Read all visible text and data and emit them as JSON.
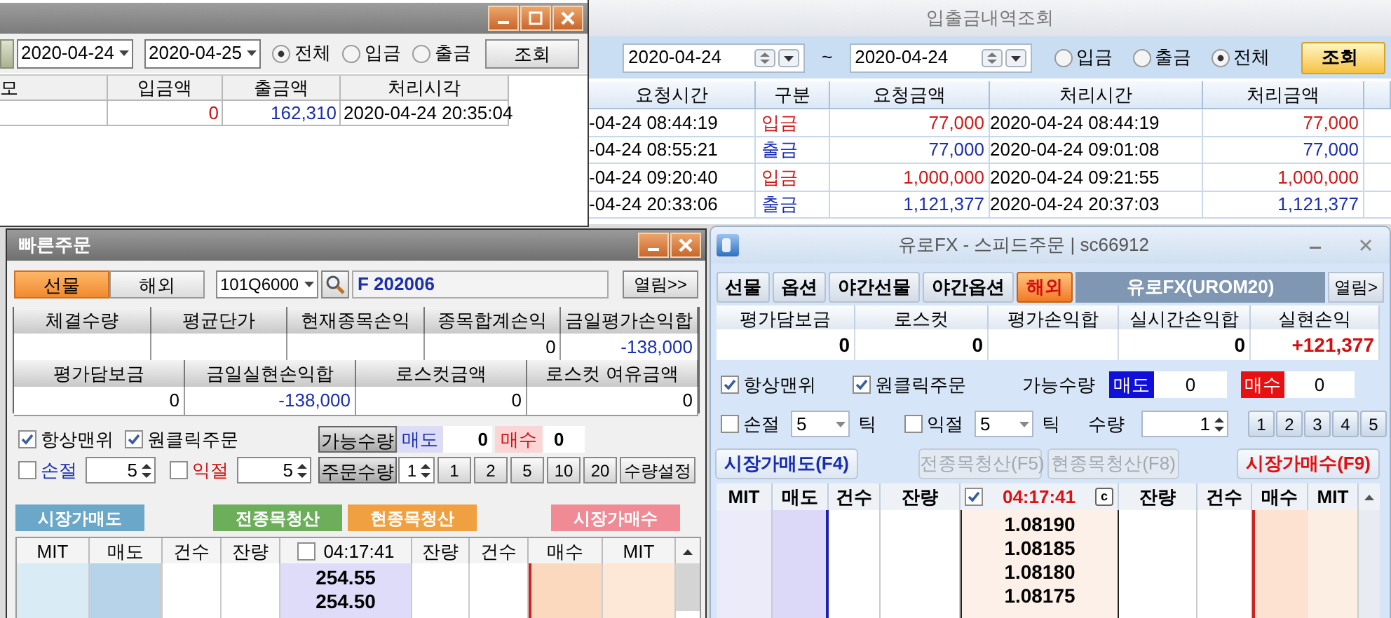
{
  "transfer_window": {
    "date_from": "2020-04-24",
    "date_to": "2020-04-25",
    "filters": [
      {
        "label": "전체",
        "selected": true
      },
      {
        "label": "입금",
        "selected": false
      },
      {
        "label": "출금",
        "selected": false
      }
    ],
    "query_button": "조회",
    "columns": [
      "모",
      "입금액",
      "출금액",
      "처리시각"
    ],
    "rows": [
      {
        "cells": [
          {
            "kind": "blank"
          },
          {
            "kind": "loss_red",
            "text": "0"
          },
          {
            "kind": "blue",
            "text": "162,310"
          },
          {
            "kind": "plain",
            "text": "2020-04-24 20:35:04"
          }
        ]
      }
    ]
  },
  "history_window": {
    "title": "입출금내역조회",
    "date_from": "2020-04-24",
    "separator": "~",
    "date_to": "2020-04-24",
    "filters": [
      {
        "label": "입금",
        "selected": false
      },
      {
        "label": "출금",
        "selected": false
      },
      {
        "label": "전체",
        "selected": true
      }
    ],
    "query_button": "조회",
    "columns": [
      "요청시간",
      "구분",
      "요청금액",
      "처리시간",
      "처리금액"
    ],
    "rows": [
      {
        "kind": "deposit",
        "cells": [
          "-04-24 08:44:19",
          "입금",
          "77,000",
          "2020-04-24 08:44:19",
          "77,000"
        ]
      },
      {
        "kind": "withdrawal",
        "cells": [
          "-04-24 08:55:21",
          "출금",
          "77,000",
          "2020-04-24 09:01:08",
          "77,000"
        ]
      },
      {
        "kind": "deposit",
        "cells": [
          "-04-24 09:20:40",
          "입금",
          "1,000,000",
          "2020-04-24 09:21:55",
          "1,000,000"
        ]
      },
      {
        "kind": "withdrawal",
        "cells": [
          "-04-24 20:33:06",
          "출금",
          "1,121,377",
          "2020-04-24 20:37:03",
          "1,121,377"
        ]
      }
    ]
  },
  "quick_order": {
    "title": "빠른주문",
    "market_tabs": [
      {
        "label": "선물",
        "selected": true
      },
      {
        "label": "해외",
        "selected": false
      }
    ],
    "symbol_code": "101Q6000",
    "symbol_name": "F 202006",
    "expand_button": "열림>>",
    "summary_1": {
      "columns": [
        "체결수량",
        "평균단가",
        "현재종목손익",
        "종목합계손익",
        "금일평가손익합"
      ],
      "values": [
        {
          "kind": "blank"
        },
        {
          "kind": "blank"
        },
        {
          "kind": "blank"
        },
        {
          "kind": "plain",
          "text": "0"
        },
        {
          "kind": "blue",
          "text": "-138,000"
        }
      ]
    },
    "summary_2": {
      "columns": [
        "평가담보금",
        "금일실현손익합",
        "로스컷금액",
        "로스컷 여유금액"
      ],
      "values": [
        {
          "kind": "plain",
          "text": "0"
        },
        {
          "kind": "blue",
          "text": "-138,000"
        },
        {
          "kind": "plain",
          "text": "0"
        },
        {
          "kind": "plain",
          "text": "0"
        }
      ]
    },
    "always_on_top": {
      "label": "항상맨위",
      "checked": true
    },
    "one_click": {
      "label": "원클릭주문",
      "checked": true
    },
    "stop_loss": {
      "label": "손절",
      "checked": false,
      "value": "5"
    },
    "take_profit": {
      "label": "익절",
      "checked": false,
      "value": "5"
    },
    "available_button": "가능수량",
    "sell_label": "매도",
    "sell_qty": "0",
    "buy_label": "매수",
    "buy_qty": "0",
    "order_qty_button": "주문수량",
    "order_qty": "1",
    "qty_presets": [
      "1",
      "2",
      "5",
      "10",
      "20"
    ],
    "qty_setting_button": "수량설정",
    "actions": [
      {
        "label": "시장가매도",
        "kind": "sell"
      },
      {
        "label": "전종목청산",
        "kind": "close_all"
      },
      {
        "label": "현종목청산",
        "kind": "close_current"
      },
      {
        "label": "시장가매수",
        "kind": "buy"
      }
    ],
    "ladder": {
      "columns_left": [
        "MIT",
        "매도",
        "건수",
        "잔량"
      ],
      "time_checked": false,
      "time": "04:17:41",
      "columns_right": [
        "잔량",
        "건수",
        "매수",
        "MIT"
      ],
      "prices": [
        "254.55",
        "254.50"
      ]
    }
  },
  "speed_order": {
    "title": "유로FX - 스피드주문 | sc66912",
    "tabs": [
      {
        "label": "선물",
        "selected": false
      },
      {
        "label": "옵션",
        "selected": false
      },
      {
        "label": "야간선물",
        "selected": false
      },
      {
        "label": "야간옵션",
        "selected": false
      },
      {
        "label": "해외",
        "selected": true
      }
    ],
    "instrument": "유로FX(UROM20)",
    "expand_button": "열림>",
    "columns": [
      "평가담보금",
      "로스컷",
      "평가손익합",
      "실시간손익합",
      "실현손익"
    ],
    "values": [
      {
        "kind": "plain",
        "text": "0"
      },
      {
        "kind": "plain",
        "text": "0"
      },
      {
        "kind": "blank"
      },
      {
        "kind": "plain",
        "text": "0"
      },
      {
        "kind": "loss_red",
        "text": "+121,377"
      }
    ],
    "always_on_top": {
      "label": "항상맨위",
      "checked": true
    },
    "one_click": {
      "label": "원클릭주문",
      "checked": true
    },
    "available_label": "가능수량",
    "sell_label": "매도",
    "sell_qty": "0",
    "buy_label": "매수",
    "buy_qty": "0",
    "stop_loss": {
      "label": "손절",
      "checked": false,
      "value": "5",
      "unit": "틱"
    },
    "take_profit": {
      "label": "익절",
      "checked": false,
      "value": "5",
      "unit": "틱"
    },
    "qty_label": "수량",
    "qty": "1",
    "qty_presets": [
      "1",
      "2",
      "3",
      "4",
      "5"
    ],
    "actions": [
      {
        "label": "시장가매도(F4)",
        "kind": "sell",
        "disabled": false
      },
      {
        "label": "전종목청산(F5)",
        "kind": "close_all",
        "disabled": true
      },
      {
        "label": "현종목청산(F8)",
        "kind": "close_current",
        "disabled": true
      },
      {
        "label": "시장가매수(F9)",
        "kind": "buy",
        "disabled": false
      }
    ],
    "ladder": {
      "columns_left": [
        "MIT",
        "매도",
        "건수",
        "잔량"
      ],
      "time_checked": true,
      "time": "04:17:41",
      "clear_button": "c",
      "columns_right": [
        "잔량",
        "건수",
        "매수",
        "MIT"
      ],
      "prices": [
        "1.08190",
        "1.08185",
        "1.08180",
        "1.08175"
      ]
    }
  }
}
